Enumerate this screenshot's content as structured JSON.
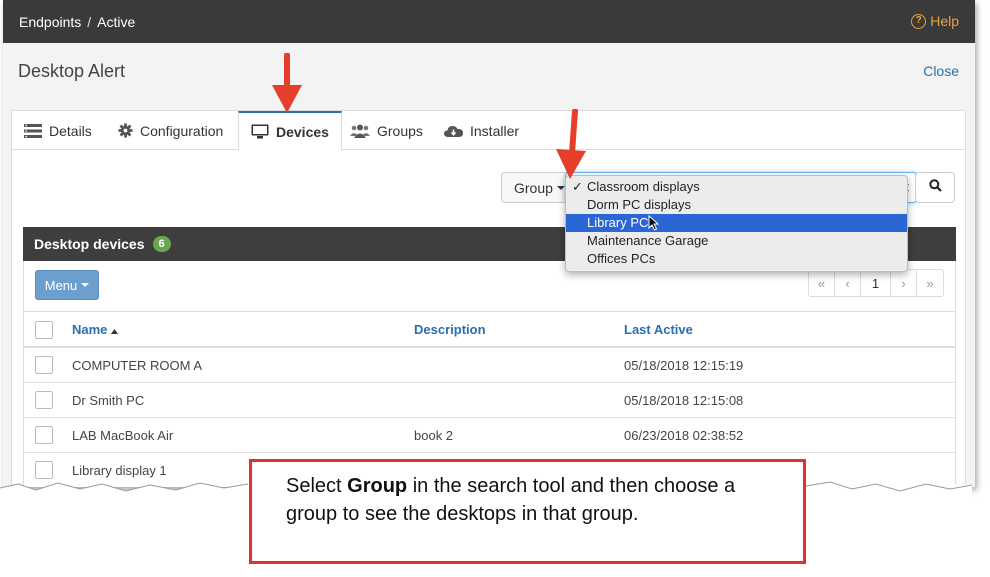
{
  "breadcrumb": {
    "parent": "Endpoints",
    "separator": "/",
    "current": "Active"
  },
  "help_label": "Help",
  "page_title": "Desktop Alert",
  "close_label": "Close",
  "tabs": [
    {
      "label": "Details",
      "icon": "list-icon"
    },
    {
      "label": "Configuration",
      "icon": "gear-icon"
    },
    {
      "label": "Devices",
      "icon": "monitor-icon"
    },
    {
      "label": "Groups",
      "icon": "users-icon"
    },
    {
      "label": "Installer",
      "icon": "cloud-download-icon"
    }
  ],
  "active_tab": "Devices",
  "search": {
    "field_label": "Group",
    "selected": "Classroom displays"
  },
  "dropdown_options": [
    {
      "label": "Classroom displays",
      "checked": true
    },
    {
      "label": "Dorm PC displays"
    },
    {
      "label": "Library PCs",
      "highlighted": true
    },
    {
      "label": "Maintenance Garage"
    },
    {
      "label": "Offices PCs"
    }
  ],
  "devices": {
    "title": "Desktop devices",
    "count": "6",
    "menu_label": "Menu",
    "pager": {
      "first": "«",
      "prev": "‹",
      "page": "1",
      "next": "›",
      "last": "»"
    },
    "columns": {
      "name": "Name",
      "description": "Description",
      "last_active": "Last Active"
    },
    "rows": [
      {
        "name": "COMPUTER ROOM A",
        "description": "",
        "last_active": "05/18/2018 12:15:19"
      },
      {
        "name": "Dr Smith PC",
        "description": "",
        "last_active": "05/18/2018 12:15:08"
      },
      {
        "name": "LAB MacBook Air",
        "description": "book 2",
        "last_active": "06/23/2018 02:38:52"
      },
      {
        "name": "Library display 1",
        "description": "",
        "last_active": ""
      }
    ]
  },
  "callout": {
    "pre": "Select ",
    "bold": "Group",
    "post": " in the search tool and then choose a group to see the desktops in that group."
  },
  "colors": {
    "topbar": "#3a3a3a",
    "link": "#2a6fb0",
    "help": "#e8a33b",
    "arrow": "#e53e2b",
    "badge": "#6aa84f",
    "selection": "#2a66d4",
    "callout_border": "#e03131"
  }
}
